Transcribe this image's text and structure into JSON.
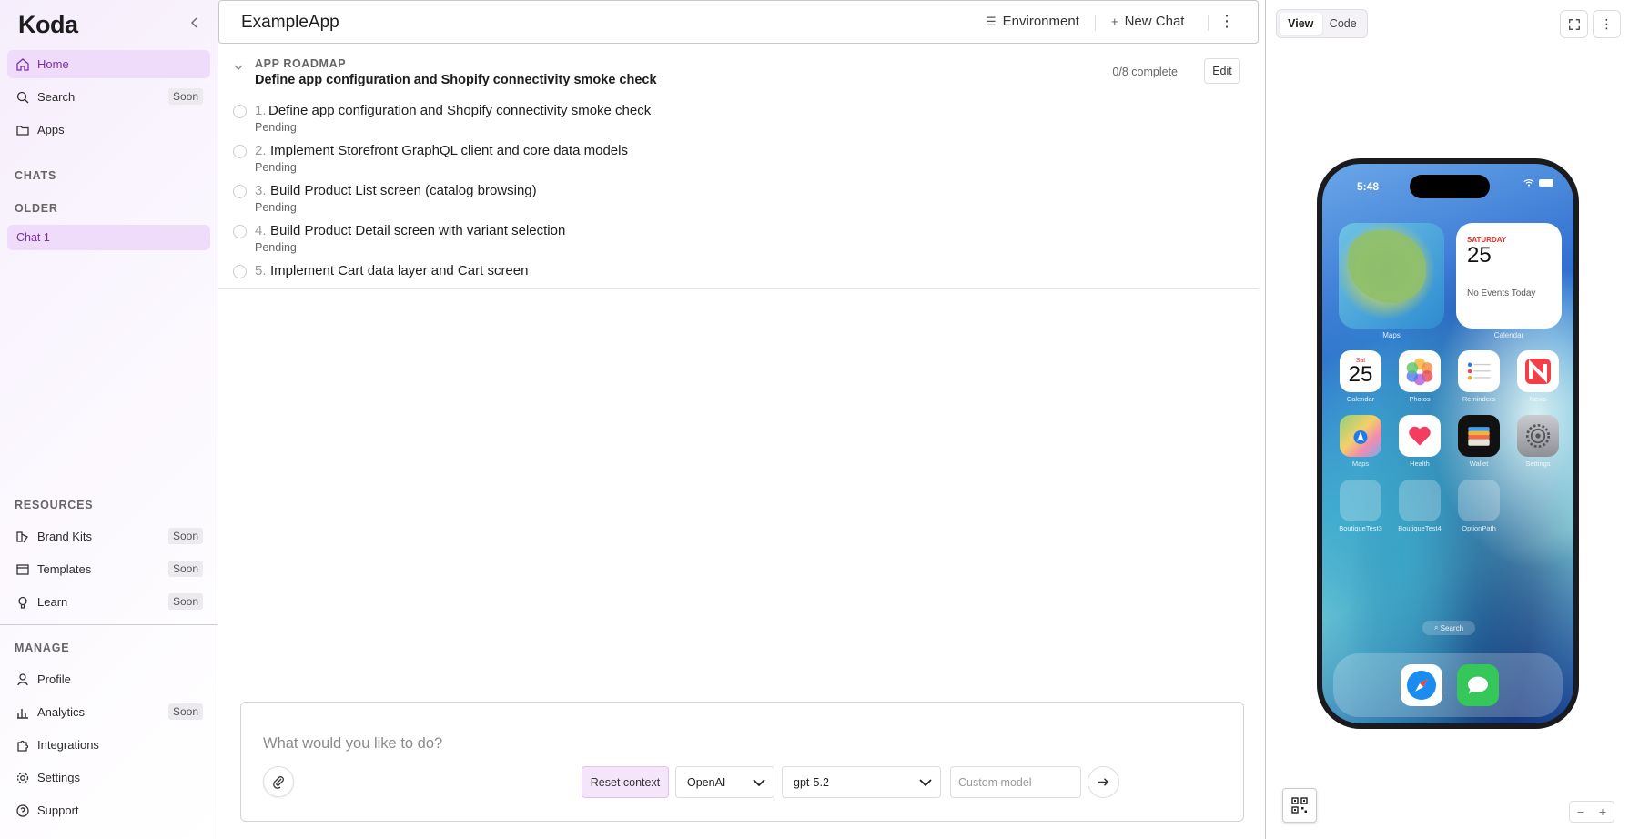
{
  "sidebar": {
    "logo": "Koda",
    "home": "Home",
    "search": "Search",
    "search_badge": "Soon",
    "apps": "Apps",
    "chats_label": "CHATS",
    "older_label": "OLDER",
    "chat_item": "Chat 1",
    "resources_label": "RESOURCES",
    "brand_kits": "Brand Kits",
    "templates": "Templates",
    "learn": "Learn",
    "soon": "Soon",
    "manage_label": "MANAGE",
    "profile": "Profile",
    "analytics": "Analytics",
    "integrations": "Integrations",
    "settings": "Settings",
    "support": "Support"
  },
  "header": {
    "title": "ExampleApp",
    "environment": "Environment",
    "new_chat": "New Chat"
  },
  "roadmap": {
    "label": "APP ROADMAP",
    "title": "Define app configuration and Shopify connectivity smoke check",
    "progress": "0/8 complete",
    "edit": "Edit",
    "tasks": [
      {
        "num": "1.",
        "text": "Define app configuration and Shopify connectivity smoke check",
        "status": "Pending"
      },
      {
        "num": "2.",
        "text": "Implement Storefront GraphQL client and core data models",
        "status": "Pending"
      },
      {
        "num": "3.",
        "text": "Build Product List screen (catalog browsing)",
        "status": "Pending"
      },
      {
        "num": "4.",
        "text": "Build Product Detail screen with variant selection",
        "status": "Pending"
      },
      {
        "num": "5.",
        "text": "Implement Cart data layer and Cart screen",
        "status": ""
      }
    ]
  },
  "composer": {
    "placeholder": "What would you like to do?",
    "reset": "Reset context",
    "provider": "OpenAI",
    "model": "gpt-5.2",
    "custom_placeholder": "Custom model"
  },
  "preview": {
    "view": "View",
    "code": "Code",
    "phone": {
      "time": "5:48",
      "cal_day": "SATURDAY",
      "cal_date": "25",
      "cal_events": "No Events Today",
      "widget_maps_label": "Maps",
      "widget_cal_label": "Calendar",
      "app_calendar_day": "Sat",
      "app_calendar_date": "25",
      "apps_row1": [
        "Calendar",
        "Photos",
        "Reminders",
        "News"
      ],
      "apps_row2": [
        "Maps",
        "Health",
        "Wallet",
        "Settings"
      ],
      "apps_row3": [
        "BoutiqueTest3",
        "BoutiqueTest4",
        "OptionPath"
      ],
      "search": "Search"
    }
  },
  "colors": {
    "accent": "#7b2fa6",
    "accent_bg": "#efdcfb"
  }
}
